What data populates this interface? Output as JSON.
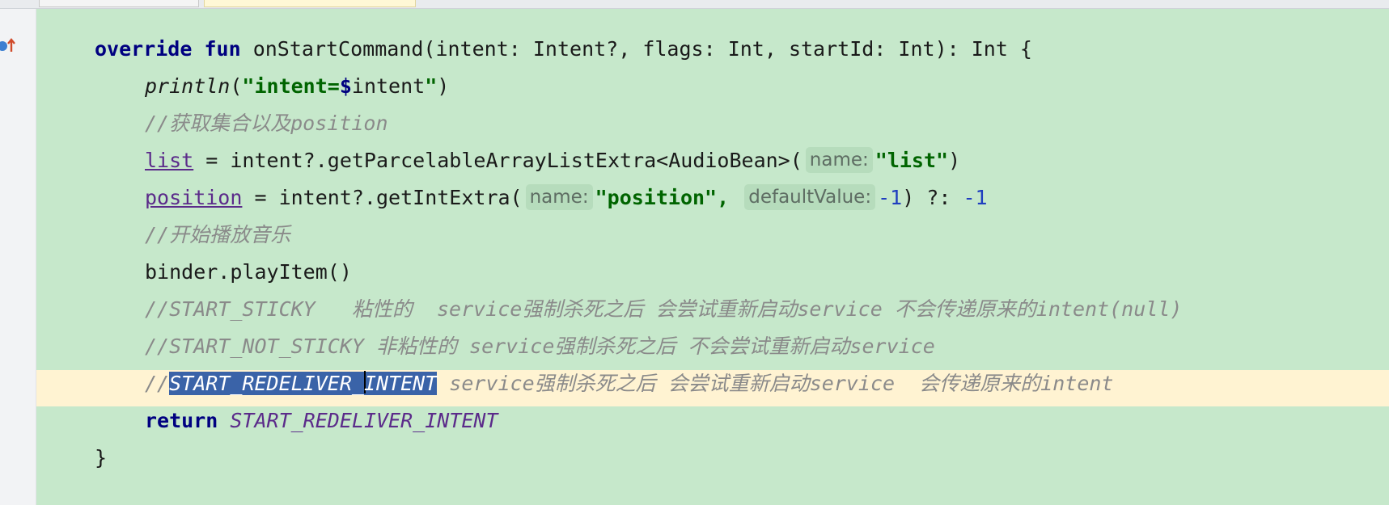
{
  "editor": {
    "lines": {
      "l1": {
        "override": "override",
        "fun": "fun",
        "rest": " onStartCommand(intent: Intent?, flags: Int, startId: Int): Int {"
      },
      "l2": {
        "println": "println",
        "open": "(",
        "str_open": "\"intent=",
        "dollar": "$",
        "str_var": "intent",
        "str_close": "\"",
        "close": ")"
      },
      "l3": {
        "comment": "//获取集合以及position"
      },
      "l4": {
        "field": "list",
        "mid": " = intent?.getParcelableArrayListExtra<AudioBean>(",
        "hint_name": "name:",
        "str": "\"list\"",
        "close": ")"
      },
      "l5": {
        "field": "position",
        "mid": " = intent?.getIntExtra(",
        "hint_name": "name:",
        "str": "\"position\",",
        "hint_default": "defaultValue:",
        "num1": "-1",
        "mid2": ") ?: ",
        "num2": "-1"
      },
      "l6": {
        "comment": "//开始播放音乐"
      },
      "l7": {
        "code": "binder.playItem()"
      },
      "l8": {
        "comment": "//START_STICKY   粘性的  service强制杀死之后 会尝试重新启动service 不会传递原来的intent(null)"
      },
      "l9": {
        "comment": "//START_NOT_STICKY 非粘性的 service强制杀死之后 不会尝试重新启动service"
      },
      "l10": {
        "comment_prefix": "//",
        "selected_a": "START_REDELIVER_",
        "selected_b": "INTENT",
        "comment_rest": " service强制杀死之后 会尝试重新启动service  会传递原来的intent"
      },
      "l11": {
        "return": "return",
        "constant": "START_REDELIVER_INTENT"
      },
      "l12": {
        "brace": "}"
      }
    },
    "gutter": {
      "icon": "override-method-icon"
    },
    "colors": {
      "background": "#c6e8cb",
      "current_line": "#fff3d2",
      "selection": "#3a63a8",
      "keyword": "#000080",
      "string": "#006400",
      "comment": "#8a8a8a"
    }
  }
}
